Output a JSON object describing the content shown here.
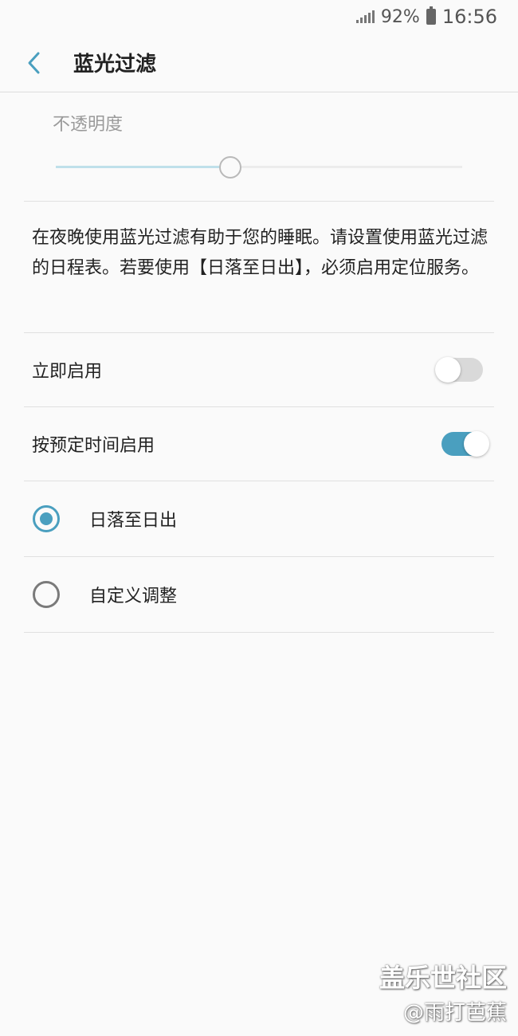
{
  "status_bar": {
    "battery_percent": "92%",
    "time": "16:56",
    "signal_icon": "signal-icon",
    "battery_icon": "battery-icon"
  },
  "app_bar": {
    "back_icon": "back-chevron-icon",
    "title": "蓝光过滤"
  },
  "opacity": {
    "label": "不透明度",
    "value": 0.43
  },
  "description": "在夜晚使用蓝光过滤有助于您的睡眠。请设置使用蓝光过滤的日程表。若要使用【日落至日出】，必须启用定位服务。",
  "toggles": [
    {
      "label": "立即启用",
      "on": false
    },
    {
      "label": "按预定时间启用",
      "on": true
    }
  ],
  "schedule_options": [
    {
      "label": "日落至日出",
      "selected": true
    },
    {
      "label": "自定义调整",
      "selected": false
    }
  ],
  "colors": {
    "accent": "#4a9fbf",
    "switch_off_track": "#d9d9d9",
    "slider_fill": "#bfe0ea"
  },
  "watermark": {
    "line1": "盖乐世社区",
    "line2": "@雨打芭蕉"
  }
}
